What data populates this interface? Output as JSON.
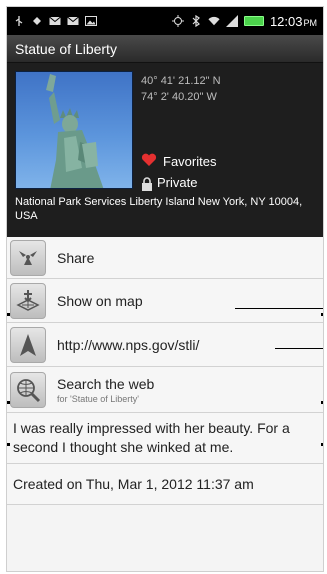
{
  "status_bar": {
    "time": "12:03",
    "ampm": "PM",
    "icons": [
      "usb-icon",
      "android-icon",
      "mail-icon",
      "mail-icon",
      "picture-icon",
      "gps-icon",
      "bluetooth-icon",
      "wifi-icon",
      "signal-icon",
      "battery-icon"
    ]
  },
  "title": "Statue of Liberty",
  "header": {
    "latitude": "40° 41' 21.12\" N",
    "longitude": "74° 2' 40.20\" W",
    "favorites_label": "Favorites",
    "private_label": "Private",
    "address": "National Park Services Liberty Island New York, NY 10004, USA"
  },
  "actions": {
    "share": "Share",
    "show_on_map": "Show on map",
    "url": "http://www.nps.gov/stli/",
    "search_web": "Search the web",
    "search_sub": "for 'Statue of Liberty'"
  },
  "note": "I was really impressed with her beauty. For a second I thought she winked at me.",
  "created": "Created on Thu, Mar 1, 2012 11:37 am",
  "colors": {
    "header_bg": "#1e1e1e",
    "list_bg": "#f6f6f6",
    "heart": "#e53030",
    "battery": "#4cd34c"
  }
}
